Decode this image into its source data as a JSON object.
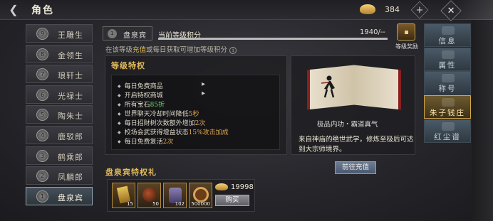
{
  "header": {
    "title": "角色",
    "gold": "384",
    "plus": "+",
    "close": "✕",
    "back": "❮"
  },
  "ranks": [
    {
      "num": "9",
      "label": "王雕生"
    },
    {
      "num": "8",
      "label": "金领生"
    },
    {
      "num": "7",
      "label": "琅轩士"
    },
    {
      "num": "6",
      "label": "光禄士"
    },
    {
      "num": "5",
      "label": "陶朱士"
    },
    {
      "num": "4",
      "label": "鹿驳郎"
    },
    {
      "num": "3",
      "label": "鹤乘郎"
    },
    {
      "num": "2",
      "label": "凤麟郎"
    },
    {
      "num": "1",
      "label": "盘泉宾"
    }
  ],
  "tier": {
    "num": "1",
    "label": "盘泉宾"
  },
  "score": {
    "label": "当前等级积分",
    "value": "1940/--",
    "progress": 1.0
  },
  "hint": {
    "pre": "在该等级",
    "highlight": "充值",
    "post": "或每日获取可增加等级积分",
    "icon": "i"
  },
  "reward": {
    "label": "等级奖励"
  },
  "privileges": {
    "title": "等级特权",
    "items": [
      {
        "text": "每日免费商品",
        "arrow": "▸"
      },
      {
        "text": "开启特权商城",
        "arrow": "▸"
      },
      {
        "pre": "所有宝石",
        "hl": "85折",
        "hl_color": "g"
      },
      {
        "pre": "世界聊天冷却时间降低",
        "hl": "5秒",
        "hl_color": "o"
      },
      {
        "pre": "每日招财树次数额外增加",
        "hl": "2次",
        "hl_color": "o"
      },
      {
        "pre": "校场会武获得增益状态",
        "hl": "15%攻击加成",
        "hl_color": "o"
      },
      {
        "pre": "每日免费复活",
        "hl": "2次",
        "hl_color": "o"
      }
    ]
  },
  "book": {
    "name": "极品内功・霸道真气",
    "description": "来自神庙的绝世武学，修炼至极后可达到大宗师境界。",
    "button": "前往充值"
  },
  "gift": {
    "title": "盘泉宾特权礼",
    "items": [
      {
        "name": "gold-token-icon",
        "qty": "15"
      },
      {
        "name": "fire-orb-icon",
        "qty": "50"
      },
      {
        "name": "scroll-icon",
        "qty": "102"
      },
      {
        "name": "coin-ring-icon",
        "qty": "500000"
      }
    ],
    "price": "19998",
    "buy": "购买"
  },
  "tabs": [
    {
      "label": "信息",
      "active": false
    },
    {
      "label": "属性",
      "active": false
    },
    {
      "label": "称号",
      "active": false
    },
    {
      "label": "朱子钱庄",
      "active": true
    },
    {
      "label": "红尘谱",
      "active": false
    }
  ]
}
